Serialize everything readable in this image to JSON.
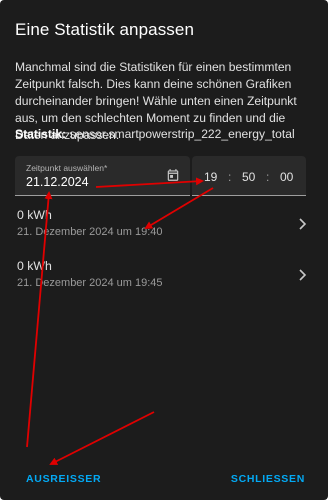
{
  "dialog": {
    "title": "Eine Statistik anpassen",
    "description": "Manchmal sind die Statistiken für einen bestimmten Zeitpunkt falsch. Dies kann deine schönen Grafiken durcheinander bringen! Wähle unten einen Zeitpunkt aus, um den schlechten Moment zu finden und die Daten anzupassen.",
    "statistic_label": "Statistik:",
    "statistic_value": "sensor.smartpowerstrip_222_energy_total"
  },
  "date_picker": {
    "label": "Zeitpunkt auswählen*",
    "value": "21.12.2024",
    "icon": "calendar-icon"
  },
  "time_picker": {
    "hours": "19",
    "minutes": "50",
    "seconds": "00",
    "separator": ":"
  },
  "entries": [
    {
      "value": "0 kWh",
      "timestamp": "21. Dezember 2024 um 19:40"
    },
    {
      "value": "0 kWh",
      "timestamp": "21. Dezember 2024 um 19:45"
    }
  ],
  "actions": {
    "left": "AUSREISSER",
    "right": "SCHLIESSEN"
  },
  "colors": {
    "background": "#1c1c1c",
    "field_background": "#2a2a2a",
    "accent": "#03a9f4",
    "annotation_arrow": "#e00000"
  }
}
